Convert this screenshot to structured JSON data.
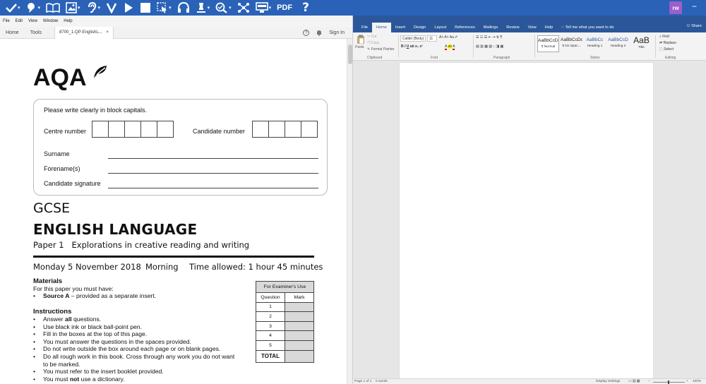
{
  "toolbar": {
    "pdf_label": "PDF",
    "help_label": "?",
    "logo_text": "rw",
    "minimize_label": "−"
  },
  "acrobat": {
    "menu": [
      "File",
      "Edit",
      "View",
      "Window",
      "Help"
    ],
    "tabs": {
      "home": "Home",
      "tools": "Tools"
    },
    "doc_tab": "8700_1-QP-EnglishL...",
    "doc_close": "×",
    "sign_in": "Sign In",
    "help_icon_label": "?"
  },
  "exam": {
    "logo_text": "AQA",
    "instruction": "Please write clearly in block capitals.",
    "centre_number_label": "Centre number",
    "candidate_number_label": "Candidate number",
    "surname_label": "Surname",
    "forenames_label": "Forename(s)",
    "signature_label": "Candidate signature",
    "qualification": "GCSE",
    "subject": "ENGLISH LANGUAGE",
    "paper": "Paper 1   Explorations in creative reading and writing",
    "date": "Monday 5 November 2018",
    "session": "Morning",
    "time_allowed": "Time allowed: 1 hour 45 minutes",
    "materials_heading": "Materials",
    "materials_intro": "For this paper you must have:",
    "materials_item_bold": "Source A",
    "materials_item_rest": " – provided as a separate insert.",
    "instructions_heading": "Instructions",
    "instructions": {
      "i1_pre": "Answer ",
      "i1_bold": "all",
      "i1_post": " questions.",
      "i2": "Use black ink or black ball-point pen.",
      "i3": "Fill in the boxes at the top of this page.",
      "i4": "You must answer the questions in the spaces provided.",
      "i5": "Do not write outside the box around each page or on blank pages.",
      "i6a": "Do all rough work in this book.  Cross through any work you do not want",
      "i6b": "to be marked.",
      "i7": "You must refer to the insert booklet provided.",
      "i8_pre": "You must ",
      "i8_bold": "not",
      "i8_post": " use a dictionary."
    },
    "bullet": "•",
    "examiner": {
      "heading": "For Examiner's Use",
      "col_question": "Question",
      "col_mark": "Mark",
      "rows": [
        "1",
        "2",
        "3",
        "4",
        "5"
      ],
      "total": "TOTAL"
    }
  },
  "word": {
    "tabs": [
      "File",
      "Home",
      "Insert",
      "Design",
      "Layout",
      "References",
      "Mailings",
      "Review",
      "View",
      "Help"
    ],
    "tell_me": "Tell me what you want to do",
    "share": "Share",
    "clipboard": {
      "paste": "Paste",
      "cut": "Cut",
      "copy": "Copy",
      "format_painter": "Format Painter",
      "group": "Clipboard"
    },
    "font": {
      "name": "Calibri (Body)",
      "size": "11",
      "group": "Font"
    },
    "paragraph_group": "Paragraph",
    "styles": [
      {
        "sample": "AaBbCcDc",
        "name": "¶ Normal"
      },
      {
        "sample": "AaBbCcDc",
        "name": "¶ No Spac..."
      },
      {
        "sample": "AaBbCc",
        "name": "Heading 1"
      },
      {
        "sample": "AaBbCcD",
        "name": "Heading 2"
      },
      {
        "sample": "AaB",
        "name": "Title"
      }
    ],
    "styles_group": "Styles",
    "editing": {
      "find": "Find",
      "replace": "Replace",
      "select": "Select",
      "group": "Editing"
    },
    "status": {
      "page": "Page 1 of 1",
      "words": "0 words",
      "display_settings": "Display Settings",
      "zoom": "100%"
    }
  }
}
